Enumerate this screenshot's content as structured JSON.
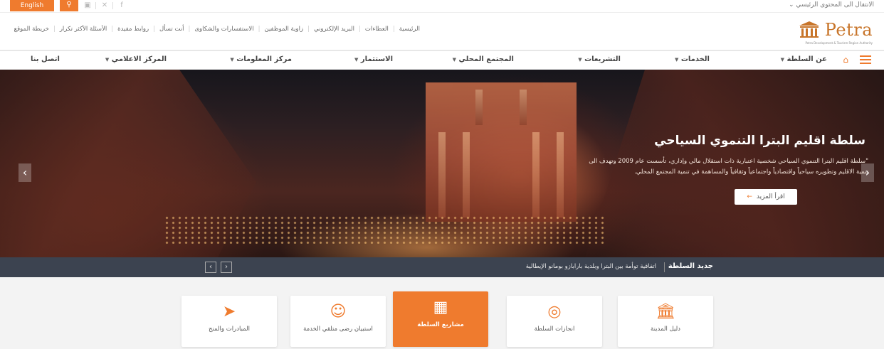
{
  "topbar": {
    "language_label": "English",
    "skip_link": "الانتقال الى المحتوى الرئيسي",
    "icons": [
      "search-icon",
      "accessibility-icon",
      "x-social-icon",
      "facebook-icon"
    ]
  },
  "header": {
    "quick_links": [
      "الرئيسية",
      "العطاءات",
      "البريد الإلكتروني",
      "زاوية الموظفين",
      "الاستفسارات والشكاوى",
      "أنت تسأل",
      "روابط مفيدة",
      "الأسئلة الأكثر تكرار",
      "خريطة الموقع"
    ],
    "logo_text": "Petra",
    "logo_tagline": "Petra Development & Tourism Region Authority"
  },
  "nav": {
    "items": [
      {
        "label": "عن السلطة",
        "has_dropdown": true
      },
      {
        "label": "الخدمات",
        "has_dropdown": true
      },
      {
        "label": "التشريعات",
        "has_dropdown": true
      },
      {
        "label": "المجتمع المحلي",
        "has_dropdown": true
      },
      {
        "label": "الاستثمار",
        "has_dropdown": true
      },
      {
        "label": "مركز المعلومات",
        "has_dropdown": true
      },
      {
        "label": "المركز الاعلامي",
        "has_dropdown": true
      },
      {
        "label": "اتصل بنا",
        "has_dropdown": false
      }
    ]
  },
  "hero": {
    "title": "سلطة اقليم البترا التنموي السياحي",
    "description": "\"سلطة اقليم البترا التنموي السياحي شخصية اعتبارية ذات استقلال مالي وإداري، تأسست عام 2009 وتهدف الى تنمية الاقليم وتطويره سياحياً واقتصادياً واجتماعياً وثقافياً والمساهمة في تنمية المجتمع المحلي.",
    "button_label": "اقرأ المزيد"
  },
  "ticker": {
    "label": "جديد السلطة",
    "text": "اتفاقية توأمة بين البترا وبلدية بارابازو بومانو الإيطالية"
  },
  "services": [
    {
      "label": "دليل المدينة",
      "icon": "building-icon",
      "active": false
    },
    {
      "label": "انجازات السلطة",
      "icon": "target-icon",
      "active": false
    },
    {
      "label": "مشاريع السلطة",
      "icon": "blueprint-icon",
      "active": true
    },
    {
      "label": "استبيان رضى متلقي الخدمة",
      "icon": "survey-icon",
      "active": false
    },
    {
      "label": "المبادرات والمنح",
      "icon": "rocket-icon",
      "active": false
    }
  ],
  "colors": {
    "accent": "#ef7b2e",
    "ticker_bg": "#3c4350",
    "services_bg": "#f3f3f3"
  }
}
